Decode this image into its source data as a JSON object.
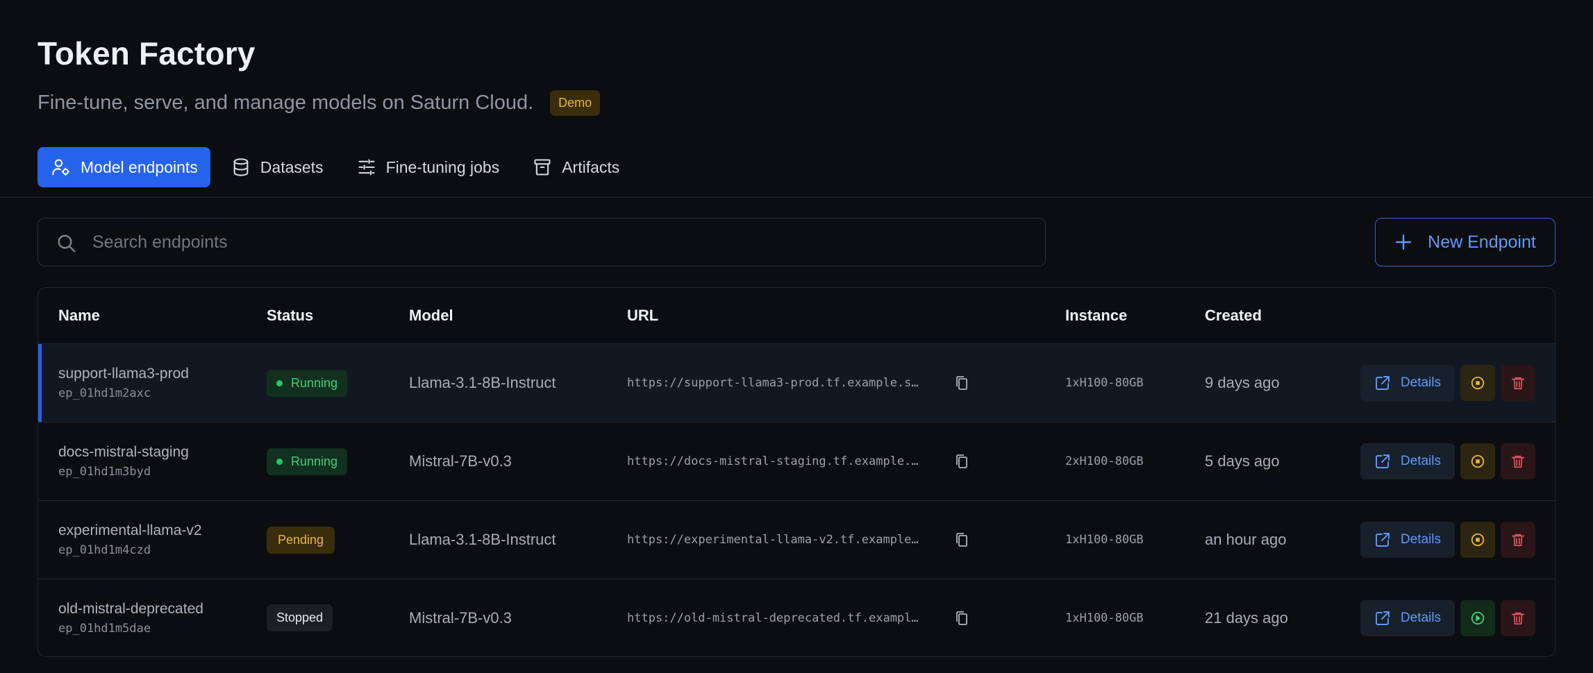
{
  "header": {
    "title": "Token Factory",
    "subtitle": "Fine-tune, serve, and manage models on Saturn Cloud.",
    "badge": "Demo"
  },
  "tabs": [
    {
      "label": "Model endpoints",
      "icon": "user-settings-icon",
      "active": true
    },
    {
      "label": "Datasets",
      "icon": "database-icon",
      "active": false
    },
    {
      "label": "Fine-tuning jobs",
      "icon": "sliders-icon",
      "active": false
    },
    {
      "label": "Artifacts",
      "icon": "archive-icon",
      "active": false
    }
  ],
  "search": {
    "placeholder": "Search endpoints",
    "value": ""
  },
  "new_endpoint_label": "New Endpoint",
  "table": {
    "headers": {
      "name": "Name",
      "status": "Status",
      "model": "Model",
      "url": "URL",
      "instance": "Instance",
      "created": "Created"
    },
    "rows": [
      {
        "name": "support-llama3-prod",
        "id": "ep_01hd1m2axc",
        "status": "Running",
        "model": "Llama-3.1-8B-Instruct",
        "url": "https://support-llama3-prod.tf.example.s…",
        "instance": "1xH100-80GB",
        "created": "9 days ago",
        "details": "Details",
        "action": "stop"
      },
      {
        "name": "docs-mistral-staging",
        "id": "ep_01hd1m3byd",
        "status": "Running",
        "model": "Mistral-7B-v0.3",
        "url": "https://docs-mistral-staging.tf.example.…",
        "instance": "2xH100-80GB",
        "created": "5 days ago",
        "details": "Details",
        "action": "stop"
      },
      {
        "name": "experimental-llama-v2",
        "id": "ep_01hd1m4czd",
        "status": "Pending",
        "model": "Llama-3.1-8B-Instruct",
        "url": "https://experimental-llama-v2.tf.example…",
        "instance": "1xH100-80GB",
        "created": "an hour ago",
        "details": "Details",
        "action": "stop"
      },
      {
        "name": "old-mistral-deprecated",
        "id": "ep_01hd1m5dae",
        "status": "Stopped",
        "model": "Mistral-7B-v0.3",
        "url": "https://old-mistral-deprecated.tf.exampl…",
        "instance": "1xH100-80GB",
        "created": "21 days ago",
        "details": "Details",
        "action": "start"
      }
    ]
  },
  "colors": {
    "accent": "#2563eb",
    "running": "#3fd07b",
    "pending": "#e8b73b",
    "danger": "#e0555f"
  }
}
